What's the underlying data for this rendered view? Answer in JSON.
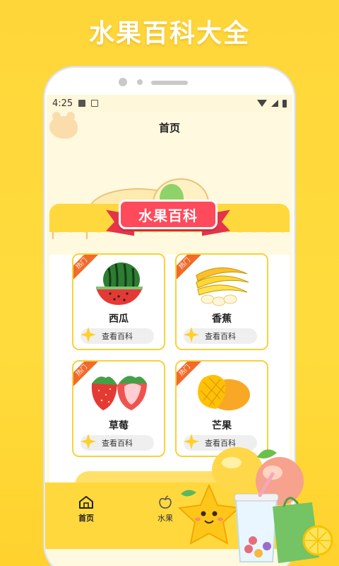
{
  "promo": {
    "title": "水果百科大全"
  },
  "status_bar": {
    "time": "4:25"
  },
  "nav": {
    "title": "首页"
  },
  "banner": {
    "text": "水果百科"
  },
  "cards": [
    {
      "name": "西瓜",
      "tag": "热门",
      "button": "查看百科",
      "icon": "watermelon-icon"
    },
    {
      "name": "香蕉",
      "tag": "热门",
      "button": "查看百科",
      "icon": "banana-icon"
    },
    {
      "name": "草莓",
      "tag": "热门",
      "button": "查看百科",
      "icon": "strawberry-icon"
    },
    {
      "name": "芒果",
      "tag": "热门",
      "button": "查看百科",
      "icon": "mango-icon"
    }
  ],
  "tabbar": {
    "items": [
      {
        "label": "首页",
        "icon": "home-icon",
        "active": true
      },
      {
        "label": "水果",
        "icon": "apple-icon",
        "active": false
      }
    ]
  },
  "colors": {
    "brand_yellow": "#FFD83E",
    "banner_red": "#FF4A5C",
    "hot_tag": "#F26A2A",
    "card_border": "#F9D13C"
  }
}
